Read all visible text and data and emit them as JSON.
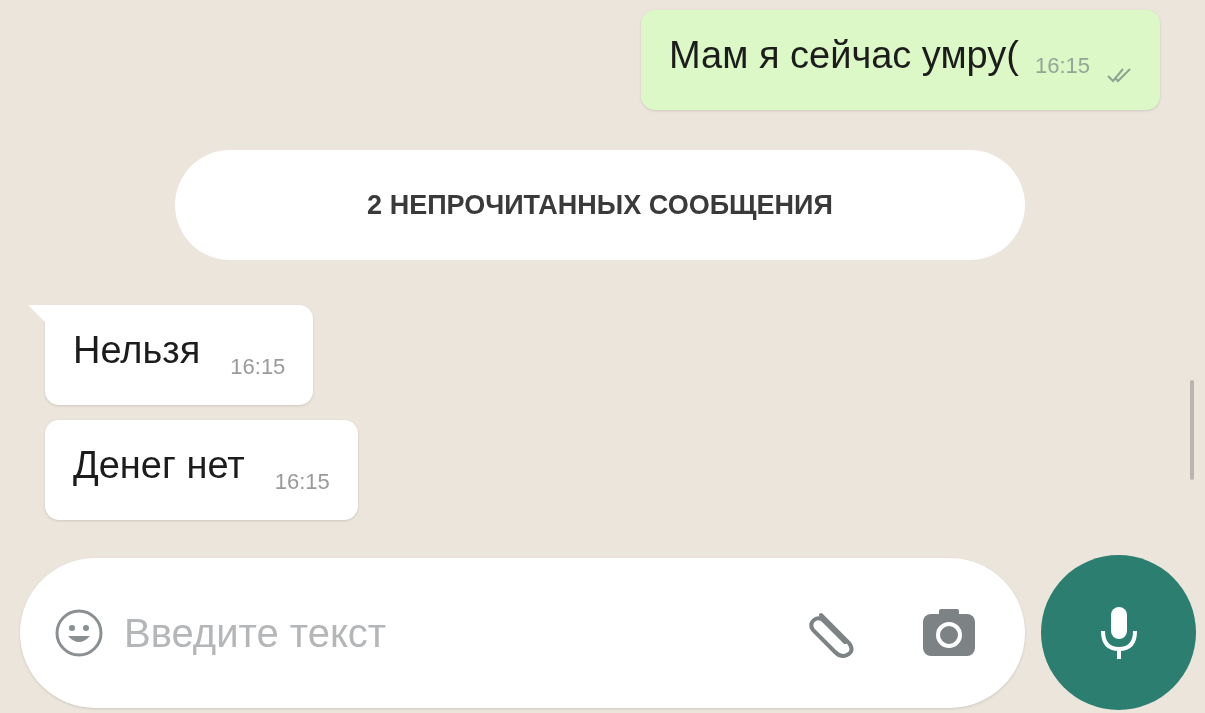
{
  "messages": [
    {
      "kind": "outgoing",
      "text": "Мам я сейчас умру(",
      "time": "16:15",
      "read": false
    },
    {
      "kind": "banner",
      "text": "2 НЕПРОЧИТАННЫХ СООБЩЕНИЯ"
    },
    {
      "kind": "incoming",
      "text": "Нельзя",
      "time": "16:15",
      "tail": true
    },
    {
      "kind": "incoming",
      "text": "Денег нет",
      "time": "16:15",
      "tail": false
    }
  ],
  "composer": {
    "placeholder": "Введите текст"
  }
}
